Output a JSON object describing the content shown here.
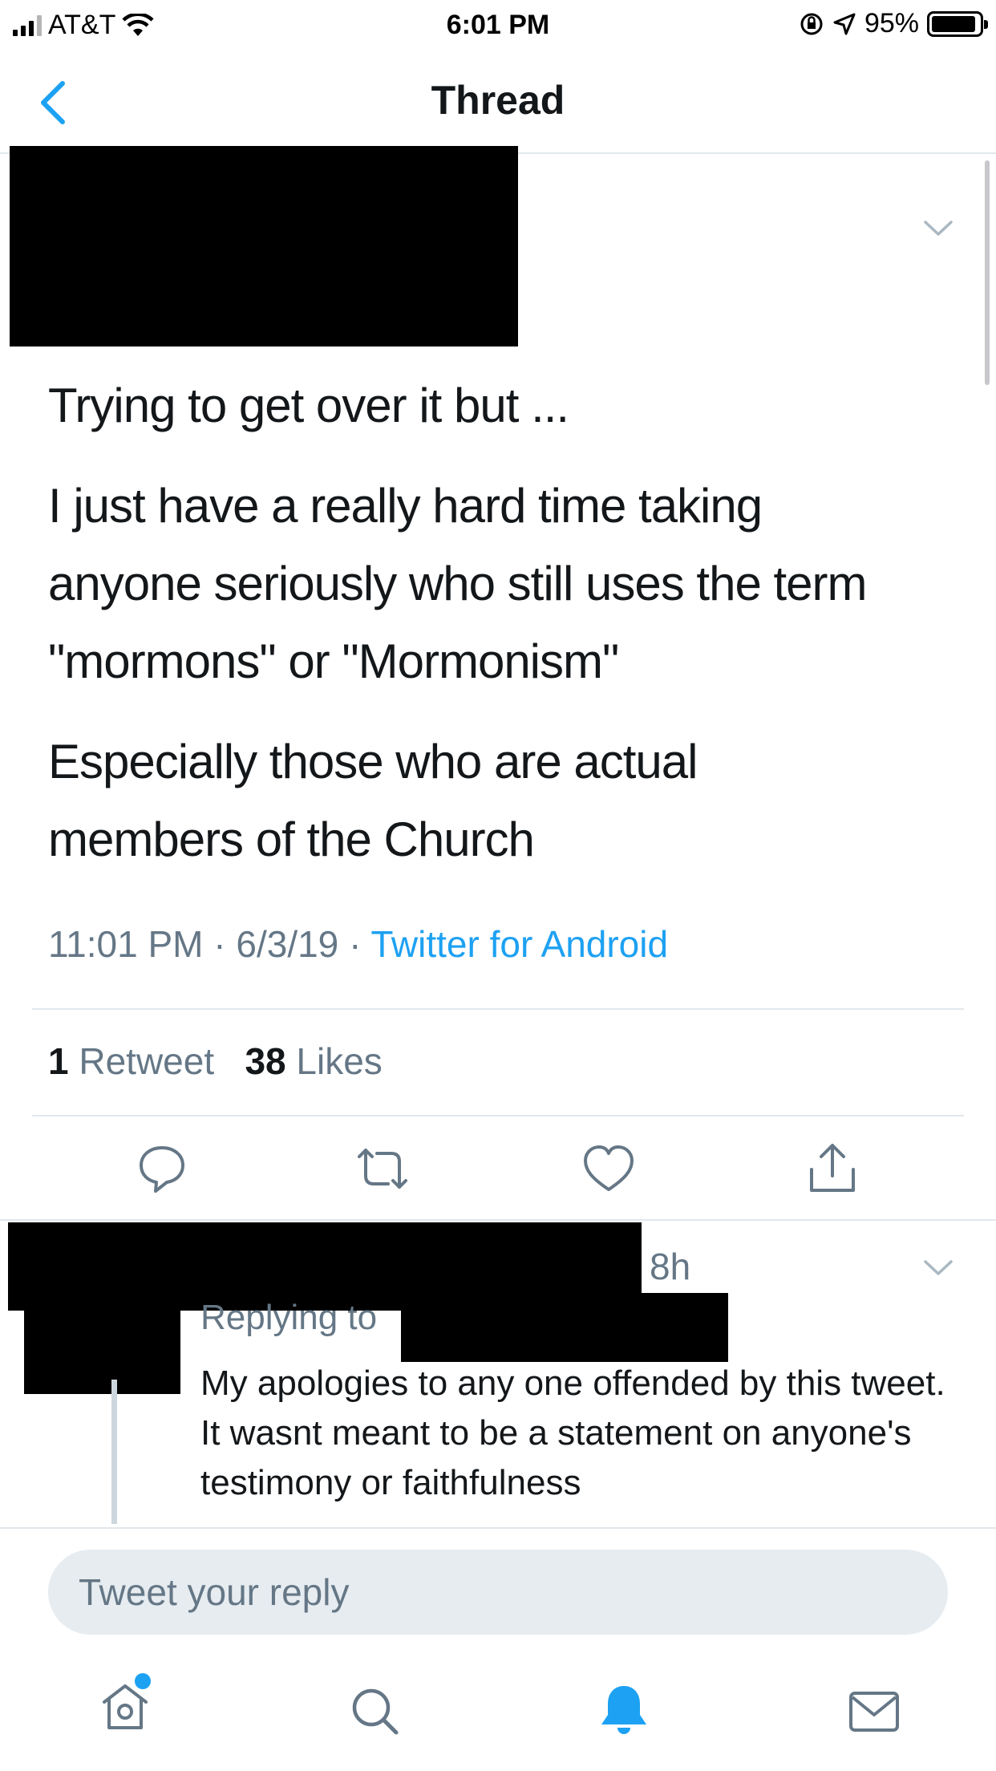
{
  "status_bar": {
    "carrier": "AT&T",
    "time": "6:01 PM",
    "battery": "95%"
  },
  "nav": {
    "title": "Thread"
  },
  "tweet": {
    "paragraphs": [
      "Trying to get over it but ...",
      "I just have a really hard time taking",
      "anyone seriously who still uses the term",
      "\"mormons\" or \"Mormonism\"",
      "Especially those who are actual",
      "members of the Church"
    ],
    "time": "11:01 PM",
    "date": "6/3/19",
    "source": "Twitter for Android",
    "retweet_count": "1",
    "retweet_label": "Retweet",
    "like_count": "38",
    "like_label": "Likes"
  },
  "reply": {
    "time": "8h",
    "replying_to_label": "Replying to",
    "text": "My apologies to any one offended by this tweet. It wasnt meant to be a statement on anyone's testimony or faithfulness"
  },
  "compose": {
    "placeholder": "Tweet your reply"
  },
  "colors": {
    "accent": "#1da1f2",
    "secondary_text": "#657786",
    "divider": "#e1e8ed"
  }
}
